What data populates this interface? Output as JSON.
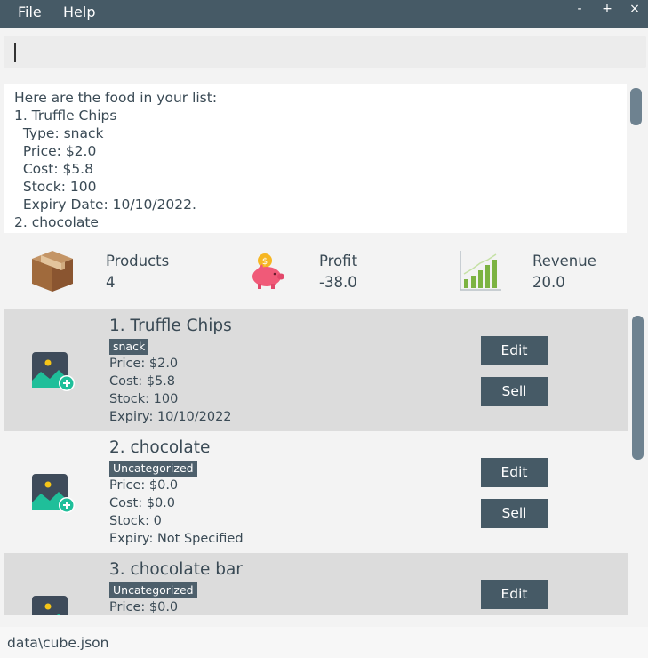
{
  "menu": {
    "file": "File",
    "help": "Help"
  },
  "window_controls": {
    "minimize": "-",
    "maximize": "+",
    "close": "×"
  },
  "command_box": {
    "value": "",
    "placeholder": ""
  },
  "result_display": {
    "text": "Here are the food in your list:\n1. Truffle Chips\n  Type: snack\n  Price: $2.0\n  Cost: $5.8\n  Stock: 100\n  Expiry Date: 10/10/2022.\n2. chocolate"
  },
  "stats": {
    "products": {
      "label": "Products",
      "value": "4",
      "icon": "box-icon"
    },
    "profit": {
      "label": "Profit",
      "value": "-38.0",
      "icon": "piggy-bank-icon"
    },
    "revenue": {
      "label": "Revenue",
      "value": "20.0",
      "icon": "bar-chart-icon"
    }
  },
  "products": [
    {
      "title": "1.  Truffle Chips",
      "tag": "snack",
      "price": "Price: $2.0",
      "cost": "Cost: $5.8",
      "stock": "Stock: 100",
      "expiry": "Expiry: 10/10/2022",
      "edit_label": "Edit",
      "sell_label": "Sell"
    },
    {
      "title": "2.  chocolate",
      "tag": "Uncategorized",
      "price": "Price: $0.0",
      "cost": "Cost: $0.0",
      "stock": "Stock: 0",
      "expiry": "Expiry: Not Specified",
      "edit_label": "Edit",
      "sell_label": "Sell"
    },
    {
      "title": "3.  chocolate bar",
      "tag": "Uncategorized",
      "price": "Price: $0.0",
      "edit_label": "Edit"
    }
  ],
  "status_bar": {
    "path": "data\\cube.json"
  },
  "colors": {
    "menubar": "#465a66",
    "accent": "#465a66",
    "card_selected": "#dcdcdc",
    "tag": "#4d5f6b"
  }
}
